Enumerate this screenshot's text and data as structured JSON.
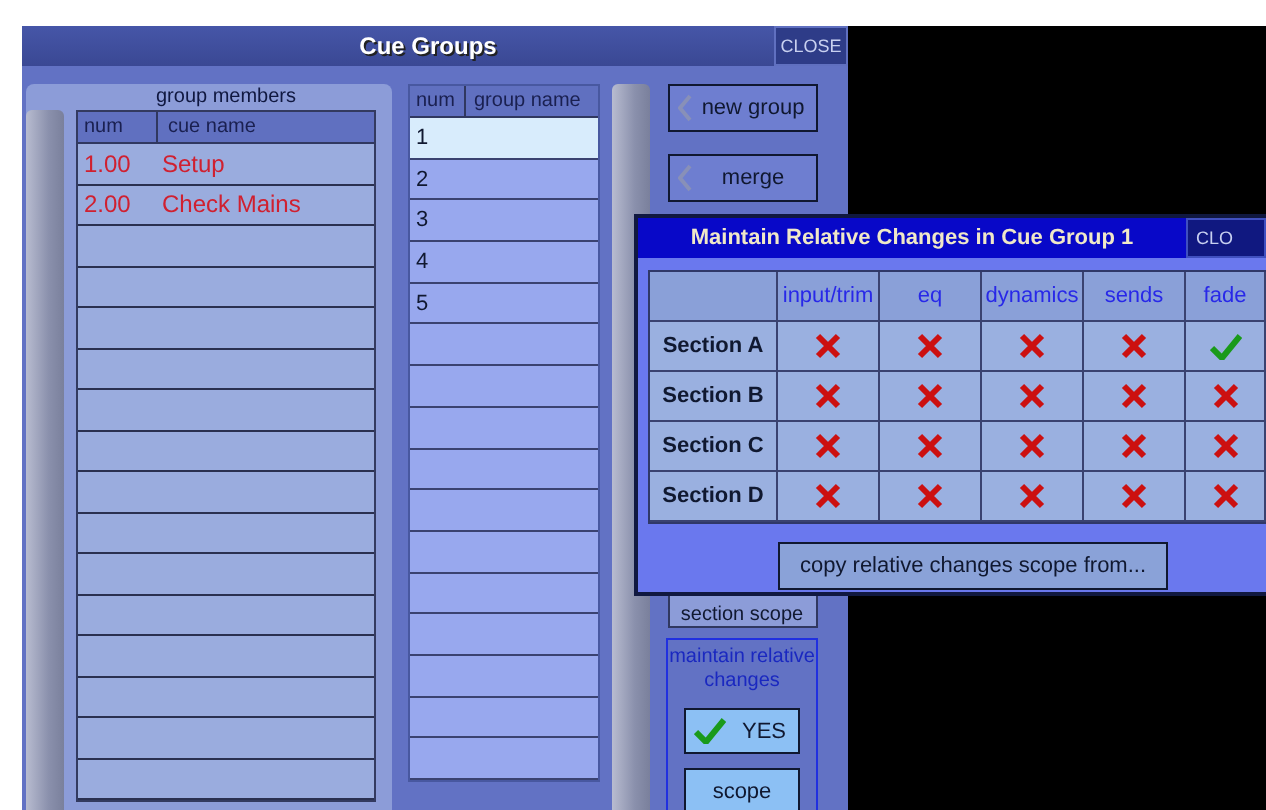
{
  "window": {
    "title": "Cue Groups",
    "close": "CLOSE"
  },
  "group_members": {
    "title": "group members",
    "columns": [
      "num",
      "cue name"
    ],
    "rows": [
      {
        "num": "1.00",
        "name": "Setup"
      },
      {
        "num": "2.00",
        "name": "Check Mains"
      }
    ]
  },
  "groups": {
    "columns": [
      "num",
      "group name"
    ],
    "rows": [
      {
        "num": "1",
        "selected": true
      },
      {
        "num": "2",
        "selected": false
      },
      {
        "num": "3",
        "selected": false
      },
      {
        "num": "4",
        "selected": false
      },
      {
        "num": "5",
        "selected": false
      }
    ]
  },
  "buttons": [
    {
      "label": "new group",
      "arrow": true
    },
    {
      "label": "merge",
      "arrow": true
    },
    {
      "label": "section scope",
      "arrow": false
    }
  ],
  "maintain": {
    "title": "maintain relative changes",
    "toggle": {
      "label": "YES",
      "on": true
    },
    "scope_button": "scope"
  },
  "dialog": {
    "title": "Maintain Relative Changes in Cue Group 1",
    "close": "CLO",
    "columns": [
      "input/trim",
      "eq",
      "dynamics",
      "sends",
      "fade"
    ],
    "rows": [
      {
        "label": "Section A",
        "checked": [
          false,
          false,
          false,
          false,
          true
        ]
      },
      {
        "label": "Section B",
        "checked": [
          false,
          false,
          false,
          false,
          false
        ]
      },
      {
        "label": "Section C",
        "checked": [
          false,
          false,
          false,
          false,
          false
        ]
      },
      {
        "label": "Section D",
        "checked": [
          false,
          false,
          false,
          false,
          false
        ]
      }
    ],
    "copy_button": "copy relative changes scope from..."
  }
}
